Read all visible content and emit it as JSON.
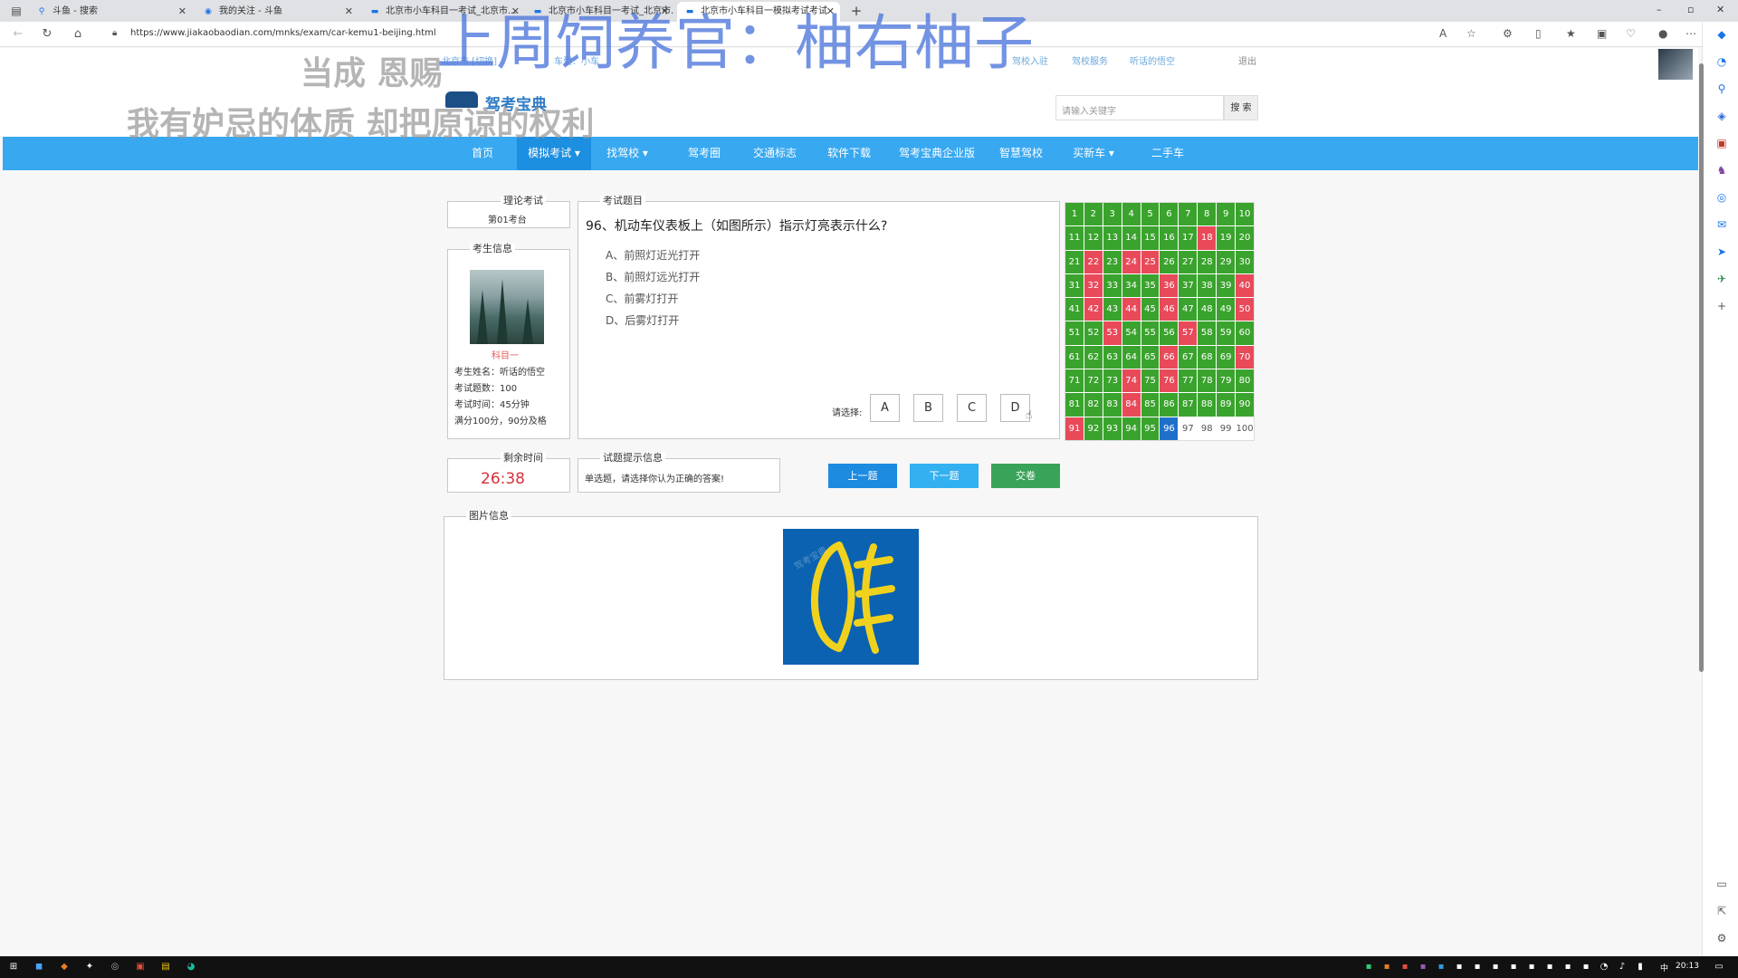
{
  "browser": {
    "tabs": [
      {
        "title": "斗鱼 - 搜索",
        "active": false
      },
      {
        "title": "我的关注 - 斗鱼",
        "active": false
      },
      {
        "title": "北京市小车科目一考试_北京市...",
        "active": false
      },
      {
        "title": "北京市小车科目一考试_北京市...",
        "active": false
      },
      {
        "title": "北京市小车科目一模拟考试考试",
        "active": true
      }
    ],
    "url": "https://www.jiakaobaodian.com/mnks/exam/car-kemu1-beijing.html",
    "new_tab": "+",
    "window_controls": [
      "–",
      "▫",
      "✕"
    ]
  },
  "site": {
    "topstrip": {
      "city": "北京市 [切换]",
      "cartype": "车型：小车",
      "links": [
        "驾校入驻",
        "驾校服务",
        "听话的悟空"
      ],
      "logout": "退出"
    },
    "logo_text": "驾考宝典",
    "search_placeholder": "请输入关键字",
    "search_button": "搜 索",
    "nav": [
      {
        "label": "首页",
        "active": false
      },
      {
        "label": "模拟考试 ▾",
        "active": true
      },
      {
        "label": "找驾校 ▾",
        "active": false
      },
      {
        "label": "驾考圈",
        "active": false
      },
      {
        "label": "交通标志",
        "active": false
      },
      {
        "label": "软件下载",
        "active": false
      },
      {
        "label": "驾考宝典企业版",
        "active": false
      },
      {
        "label": "智慧驾校",
        "active": false
      },
      {
        "label": "买新车 ▾",
        "active": false
      },
      {
        "label": "二手车",
        "active": false
      }
    ]
  },
  "exam": {
    "theory": {
      "legend": "理论考试",
      "seat": "第01考台"
    },
    "student": {
      "legend": "考生信息",
      "subject": "科目一",
      "name": "考生姓名：听话的悟空",
      "count": "考试题数：100",
      "time": "考试时间：45分钟",
      "score": "满分100分，90分及格"
    },
    "question_panel": {
      "legend": "考试题目",
      "question": "96、机动车仪表板上（如图所示）指示灯亮表示什么?",
      "options": [
        "A、前照灯近光打开",
        "B、前照灯远光打开",
        "C、前雾灯打开",
        "D、后雾灯打开"
      ],
      "choose_label": "请选择:",
      "answer_buttons": [
        "A",
        "B",
        "C",
        "D"
      ]
    },
    "remaining": {
      "legend": "剩余时间",
      "time": "26:38"
    },
    "hint": {
      "legend": "试题提示信息",
      "text": "单选题，请选择你认为正确的答案!"
    },
    "buttons": {
      "prev": "上一题",
      "next": "下一题",
      "submit": "交卷"
    },
    "image_panel": {
      "legend": "图片信息"
    },
    "image_watermark": "驾考宝典",
    "grid": {
      "current": 96,
      "wrong": [
        18,
        22,
        24,
        25,
        32,
        36,
        40,
        42,
        44,
        46,
        50,
        53,
        57,
        66,
        70,
        74,
        76,
        84,
        91
      ],
      "unanswered_from": 97
    }
  },
  "overlays": {
    "big_title": "上周饲养官：柚右柚子",
    "line1": "当成 恩赐",
    "line2": "我有妒忌的体质 却把原谅的权利"
  },
  "taskbar": {
    "time": "20:13",
    "ime": "中"
  }
}
